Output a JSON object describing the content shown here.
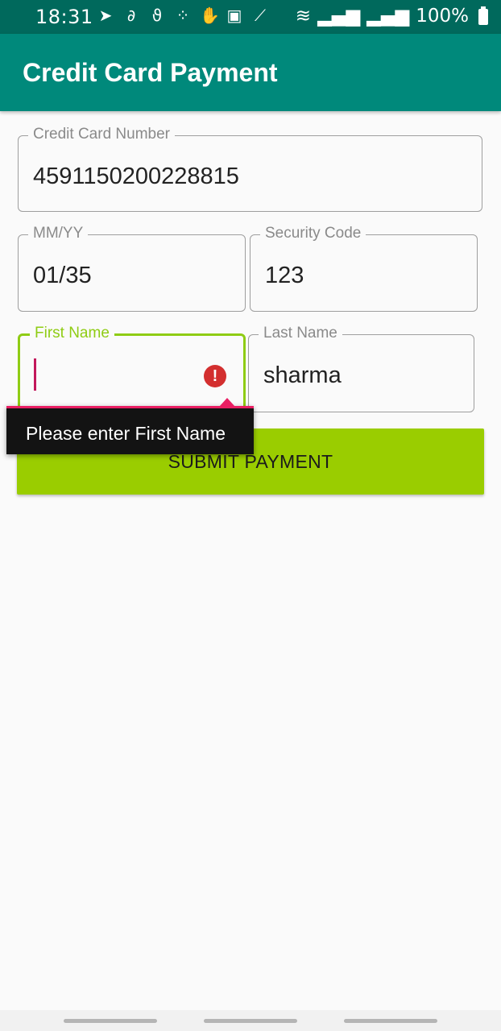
{
  "status_bar": {
    "time": "18:31",
    "battery_text": "100%",
    "icons": [
      "telegram-icon",
      "airtel-icon",
      "airtel-icon-2",
      "dots-icon",
      "hand-icon",
      "image-icon",
      "mute-icon",
      "wifi-icon",
      "signal-icon",
      "signal-icon-2",
      "battery-icon"
    ]
  },
  "app_bar": {
    "title": "Credit Card Payment"
  },
  "form": {
    "card_number": {
      "label": "Credit Card Number",
      "value": "4591150200228815"
    },
    "expiry": {
      "label": "MM/YY",
      "value": "01/35"
    },
    "security_code": {
      "label": "Security Code",
      "value": "123"
    },
    "first_name": {
      "label": "First Name",
      "value": ""
    },
    "last_name": {
      "label": "Last Name",
      "value": "sharma"
    }
  },
  "error": {
    "message": "Please enter First Name"
  },
  "submit_label": "SUBMIT PAYMENT",
  "colors": {
    "status_bar": "#00695c",
    "app_bar": "#00897b",
    "accent": "#8fcc14",
    "submit": "#9acd00",
    "error": "#d32f2f",
    "tooltip_bg": "#131313",
    "cursor": "#c2185b"
  }
}
